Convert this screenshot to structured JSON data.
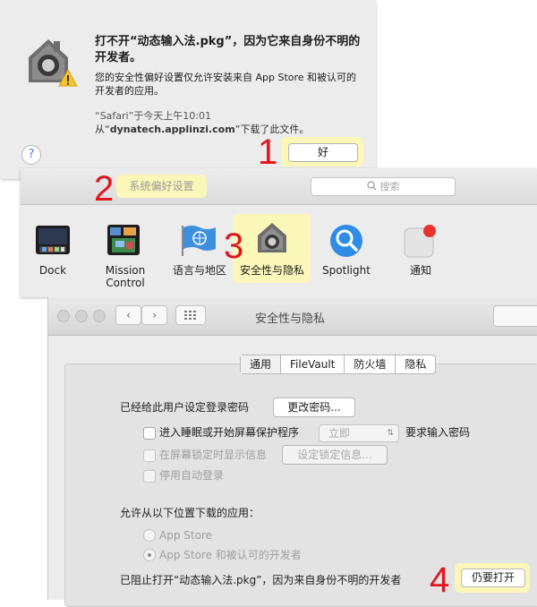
{
  "alert": {
    "title": "打不开“动态输入法.pkg”，因为它来自身份不明的开发者。",
    "message": "您的安全性偏好设置仅允许安装来自 App Store 和被认可的开发者的应用。",
    "source_line1": "“Safari”于今天上午10:01",
    "source_from": "从“",
    "source_domain": "dynatech.applinzi.com",
    "source_suffix": "”下载了此文件。",
    "help_label": "?",
    "ok_label": "好",
    "step": "1"
  },
  "prefs": {
    "title": "系统偏好设置",
    "step_title": "2",
    "search_placeholder": "搜索",
    "step_pane": "3",
    "panes": [
      {
        "label": "Dock",
        "icon": "dock-icon"
      },
      {
        "label": "Mission Control",
        "icon": "mission-control-icon"
      },
      {
        "label": "语言与地区",
        "icon": "language-region-icon"
      },
      {
        "label": "安全性与隐私",
        "icon": "security-privacy-icon"
      },
      {
        "label": "Spotlight",
        "icon": "spotlight-icon"
      },
      {
        "label": "通知",
        "icon": "notifications-icon"
      }
    ]
  },
  "security": {
    "title": "安全性与隐私",
    "back": "‹",
    "forward": "›",
    "tabs": [
      "通用",
      "FileVault",
      "防火墙",
      "隐私"
    ],
    "password_label": "已经给此用户设定登录密码",
    "change_password": "更改密码...",
    "sleep_label": "进入睡眠或开始屏幕保护程序",
    "sleep_value": "立即",
    "require_password": "要求输入密码",
    "lock_message_label": "在屏幕锁定时显示信息",
    "lock_message_button": "设定锁定信息...",
    "disable_autologin": "停用自动登录",
    "allow_apps_label": "允许从以下位置下载的应用：",
    "option_appstore": "App Store",
    "option_identified": "App Store 和被认可的开发者",
    "blocked_message": "已阻止打开“动态输入法.pkg”，因为来自身份不明的开发者",
    "open_anyway": "仍要打开",
    "step": "4"
  },
  "colors": {
    "highlight": "#fbf7b8",
    "step_number": "#e0161c"
  }
}
